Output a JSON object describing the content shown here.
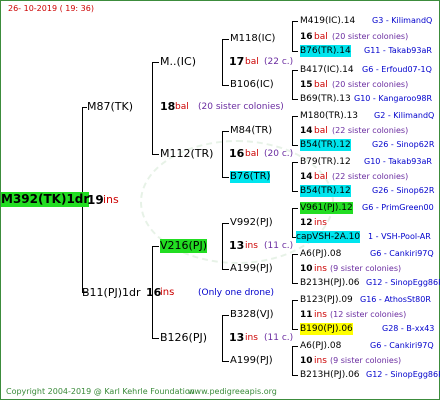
{
  "date": "26- 10-2019 ( 19: 36)",
  "root": {
    "name": "M392(TK)1dr",
    "num": "19",
    "suffix": "ins"
  },
  "g1": [
    {
      "name": "M87(TK)"
    },
    {
      "name": "B11(PJ)1dr",
      "num": "16",
      "suffix": "ins",
      "note": "(Only one drone)"
    }
  ],
  "g2": [
    {
      "name": "M..(IC)",
      "num": "18",
      "suffix": "bal",
      "note": "(20 sister colonies)"
    },
    {
      "name": "M112(TR)",
      "num": "16",
      "suffix": "bal",
      "note": "(20 c.)"
    },
    {
      "name": "V216(PJ)",
      "num": "13",
      "suffix": "ins",
      "note": "(11 c.)"
    },
    {
      "name": "B126(PJ)",
      "num": "13",
      "suffix": "ins",
      "note": "(11 c.)"
    }
  ],
  "g3": [
    {
      "name": "M118(IC)",
      "num": "17",
      "suffix": "bal",
      "note": "(22 c.)"
    },
    {
      "name": "B106(IC)"
    },
    {
      "name": "M84(TR)"
    },
    {
      "name": "B76(TR)"
    },
    {
      "name": "V992(PJ)"
    },
    {
      "name": "A199(PJ)"
    },
    {
      "name": "B328(VJ)"
    },
    {
      "name": "A199(PJ)"
    }
  ],
  "g4": [
    {
      "name": "M419(IC).14",
      "breeder": "G3 - KilimandQ"
    },
    {
      "num": "16",
      "suffix": "bal",
      "note": "(20 sister colonies)"
    },
    {
      "name": "B76(TR).14",
      "breeder": "G11 - Takab93aR"
    },
    {
      "name": "B417(IC).14",
      "breeder": "G6 - Erfoud07-1Q"
    },
    {
      "num": "15",
      "suffix": "bal",
      "note": "(20 sister colonies)"
    },
    {
      "name": "B69(TR).13",
      "breeder": "G10 - Kangaroo98R"
    },
    {
      "name": "M180(TR).13",
      "breeder": "G2 - KilimandQ"
    },
    {
      "num": "14",
      "suffix": "bal",
      "note": "(22 sister colonies)"
    },
    {
      "name": "B54(TR).12",
      "breeder": "G26 - Sinop62R"
    },
    {
      "name": "B79(TR).12",
      "breeder": "G10 - Takab93aR"
    },
    {
      "num": "14",
      "suffix": "bal",
      "note": "(22 sister colonies)"
    },
    {
      "name": "B54(TR).12",
      "breeder": "G26 - Sinop62R"
    },
    {
      "name": "V961(PJ).12",
      "breeder": "G6 - PrimGreen00"
    },
    {
      "num": "12",
      "suffix": "ins"
    },
    {
      "name": "capVSH-2A.10",
      "breeder": "1 - VSH-Pool-AR"
    },
    {
      "name": "A6(PJ).08",
      "breeder": "G6 - Cankiri97Q"
    },
    {
      "num": "10",
      "suffix": "ins",
      "note": "(9 sister colonies)"
    },
    {
      "name": "B213H(PJ).06",
      "breeder": "G12 - SinopEgg86R"
    },
    {
      "name": "B123(PJ).09",
      "breeder": "G16 - AthosSt80R"
    },
    {
      "num": "11",
      "suffix": "ins",
      "note": "(12 sister colonies)"
    },
    {
      "name": "B190(PJ).06",
      "breeder": "G28 - B-xx43"
    },
    {
      "name": "A6(PJ).08",
      "breeder": "G6 - Cankiri97Q"
    },
    {
      "num": "10",
      "suffix": "ins",
      "note": "(9 sister colonies)"
    },
    {
      "name": "B213H(PJ).06",
      "breeder": "G12 - SinopEgg86R"
    }
  ],
  "footer": {
    "copyright": "Copyright 2004-2019 @ Karl Kehrle Foundation",
    "site": "www.pedigreeapis.org"
  },
  "colors": {
    "frame": "#3c8c3c",
    "hl_green": "#22dd22",
    "hl_cyan": "#00e5ee",
    "hl_yellow": "#ffff00",
    "breeder_text": "#0000cc",
    "note_text": "#6a2ca0",
    "suffix_text": "#cc0000"
  }
}
